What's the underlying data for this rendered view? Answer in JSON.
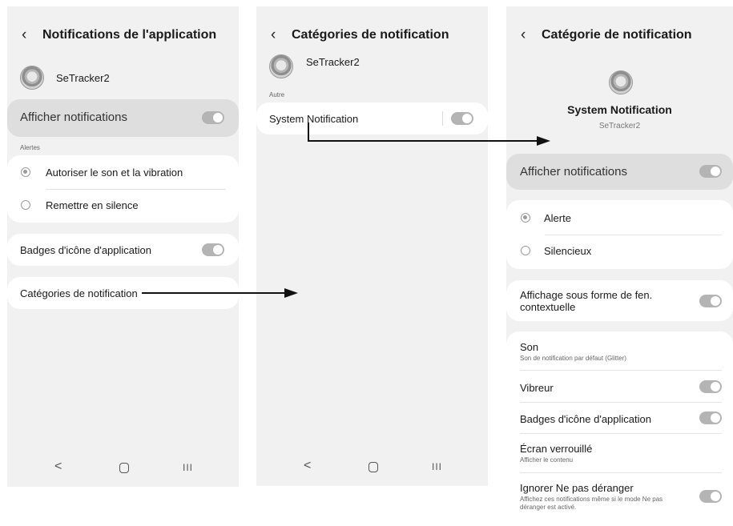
{
  "screen1": {
    "title": "Notifications de l'application",
    "app_name": "SeTracker2",
    "show_notifications": "Afficher notifications",
    "alerts_header": "Alertes",
    "radio_sound": "Autoriser le son et la vibration",
    "radio_silent": "Remettre en silence",
    "badges": "Badges d'icône d'application",
    "categories": "Catégories de notification"
  },
  "screen2": {
    "title": "Catégories de notification",
    "app_name": "SeTracker2",
    "section_other": "Autre",
    "system_notification": "System Notification"
  },
  "screen3": {
    "title": "Catégorie de notification",
    "heading": "System Notification",
    "app_name": "SeTracker2",
    "show_notifications": "Afficher notifications",
    "radio_alert": "Alerte",
    "radio_silent": "Silencieux",
    "popup": "Affichage sous forme de fen. contextuelle",
    "sound": "Son",
    "sound_sub": "Son de notification par défaut (Glitter)",
    "vibrate": "Vibreur",
    "badges": "Badges d'icône d'application",
    "lock_screen": "Écran verrouillé",
    "lock_screen_sub": "Afficher le contenu",
    "dnd": "Ignorer Ne pas déranger",
    "dnd_sub": "Affichez ces notifications même si le mode Ne pas déranger est activé."
  },
  "navbar": {
    "back": "<",
    "recent": "III"
  },
  "colors": {
    "screen_bg": "#f1f1f1",
    "card_bg": "#ffffff",
    "toggle": "#b4b4b4",
    "arrow": "#111111"
  }
}
